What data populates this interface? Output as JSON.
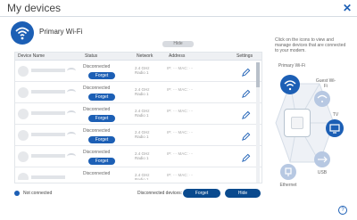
{
  "window": {
    "title": "My devices",
    "close_glyph": "✕"
  },
  "primary": {
    "label": "Primary Wi-Fi"
  },
  "hide_button": {
    "label": "Hide"
  },
  "table": {
    "columns": [
      "Device Name",
      "Status",
      "Network",
      "Address",
      "Settings"
    ],
    "rows": [
      {
        "status": "Disconnected",
        "forget": "Forget",
        "network": "2.4 GHz Radio 1",
        "address": "IP: ··· MAC: ···"
      },
      {
        "status": "Disconnected",
        "forget": "Forget",
        "network": "2.4 GHz Radio 1",
        "address": "IP: ··· MAC: ···"
      },
      {
        "status": "Disconnected",
        "forget": "Forget",
        "network": "2.4 GHz Radio 1",
        "address": "IP: ··· MAC: ···"
      },
      {
        "status": "Disconnected",
        "forget": "Forget",
        "network": "2.4 GHz Radio 1",
        "address": "IP: ··· MAC: ···"
      },
      {
        "status": "Disconnected",
        "forget": "Forget",
        "network": "2.4 GHz Radio 1",
        "address": "IP: ··· MAC: ···"
      },
      {
        "status": "Disconnected",
        "forget": "Forget",
        "network": "2.4 GHz Radio 1",
        "address": "IP: ··· MAC: ···"
      }
    ]
  },
  "legend": {
    "label": "Not connected"
  },
  "footer": {
    "disconnected_label": "Disconnected devices:",
    "forget_label": "Forget",
    "hide_label": "Hide",
    "help_glyph": "?"
  },
  "sidebar": {
    "info": "Click on the icons to view and manage devices that are connected to your modem.",
    "nodes": {
      "primary": "Primary Wi-Fi",
      "guest": "Guest Wi-Fi",
      "tv": "TV",
      "usb": "USB",
      "ethernet": "Ethernet"
    }
  },
  "colors": {
    "accent": "#1c5fb5",
    "button_dark": "#0a4a8e"
  }
}
